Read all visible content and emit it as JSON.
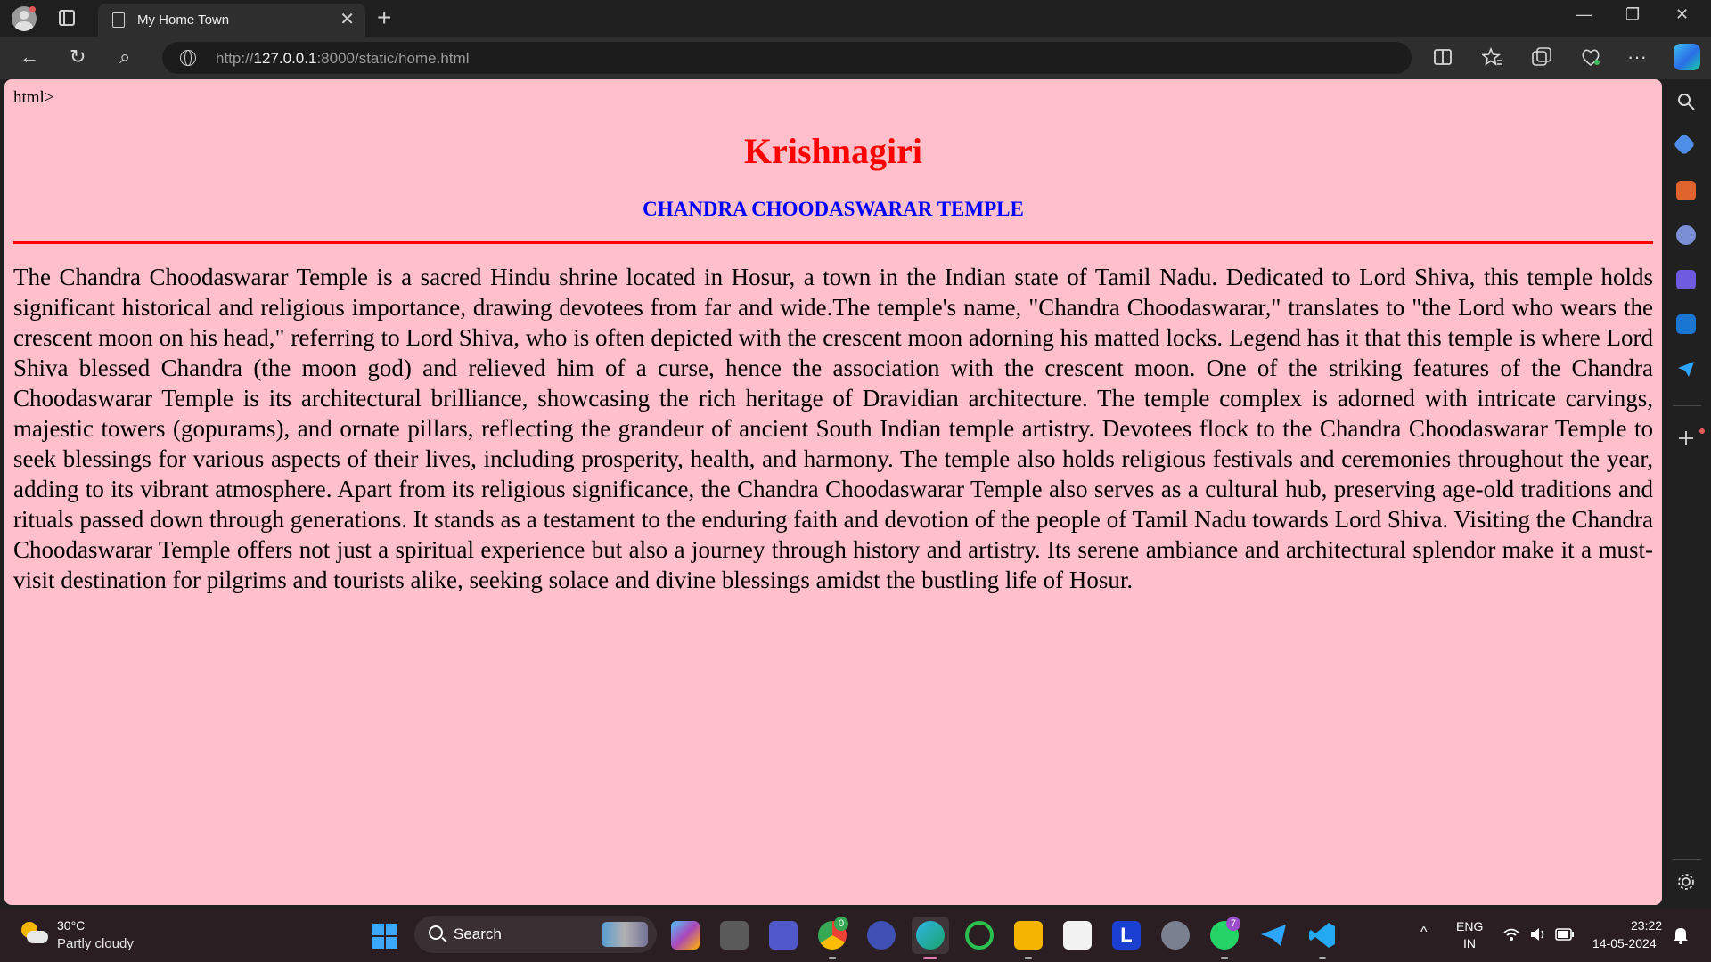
{
  "browser": {
    "tab_title": "My Home Town",
    "tab_close": "✕",
    "new_tab": "+",
    "url_scheme": "http://",
    "url_host": "127.0.0.1",
    "url_rest": ":8000/static/home.html",
    "window_controls": {
      "minimize": "—",
      "restore": "❐",
      "close": "✕"
    },
    "toolbar_icons": {
      "back": "←",
      "refresh": "↻",
      "search": "⌕",
      "more": "···"
    }
  },
  "page": {
    "stray_text": "html>",
    "heading": "Krishnagiri",
    "subheading": "CHANDRA CHOODASWARAR TEMPLE",
    "paragraph": "The Chandra Choodaswarar Temple is a sacred Hindu shrine located in Hosur, a town in the Indian state of Tamil Nadu. Dedicated to Lord Shiva, this temple holds significant historical and religious importance, drawing devotees from far and wide.The temple's name, \"Chandra Choodaswarar,\" translates to \"the Lord who wears the crescent moon on his head,\" referring to Lord Shiva, who is often depicted with the crescent moon adorning his matted locks. Legend has it that this temple is where Lord Shiva blessed Chandra (the moon god) and relieved him of a curse, hence the association with the crescent moon. One of the striking features of the Chandra Choodaswarar Temple is its architectural brilliance, showcasing the rich heritage of Dravidian architecture. The temple complex is adorned with intricate carvings, majestic towers (gopurams), and ornate pillars, reflecting the grandeur of ancient South Indian temple artistry. Devotees flock to the Chandra Choodaswarar Temple to seek blessings for various aspects of their lives, including prosperity, health, and harmony. The temple also holds religious festivals and ceremonies throughout the year, adding to its vibrant atmosphere. Apart from its religious significance, the Chandra Choodaswarar Temple also serves as a cultural hub, preserving age-old traditions and rituals passed down through generations. It stands as a testament to the enduring faith and devotion of the people of Tamil Nadu towards Lord Shiva. Visiting the Chandra Choodaswarar Temple offers not just a spiritual experience but also a journey through history and artistry. Its serene ambiance and architectural splendor make it a must-visit destination for pilgrims and tourists alike, seeking solace and divine blessings amidst the bustling life of Hosur.",
    "colors": {
      "background": "#ffc0cb",
      "heading": "#ff0000",
      "subheading": "#0000ff",
      "rule": "#ff0000"
    }
  },
  "taskbar": {
    "weather_temp": "30°C",
    "weather_desc": "Partly cloudy",
    "search_label": "Search",
    "chrome_badge": "0",
    "whatsapp_badge": "7",
    "store_letter": "L",
    "lang_top": "ENG",
    "lang_bottom": "IN",
    "time": "23:22",
    "date": "14-05-2024",
    "tray_chevron": "^"
  }
}
